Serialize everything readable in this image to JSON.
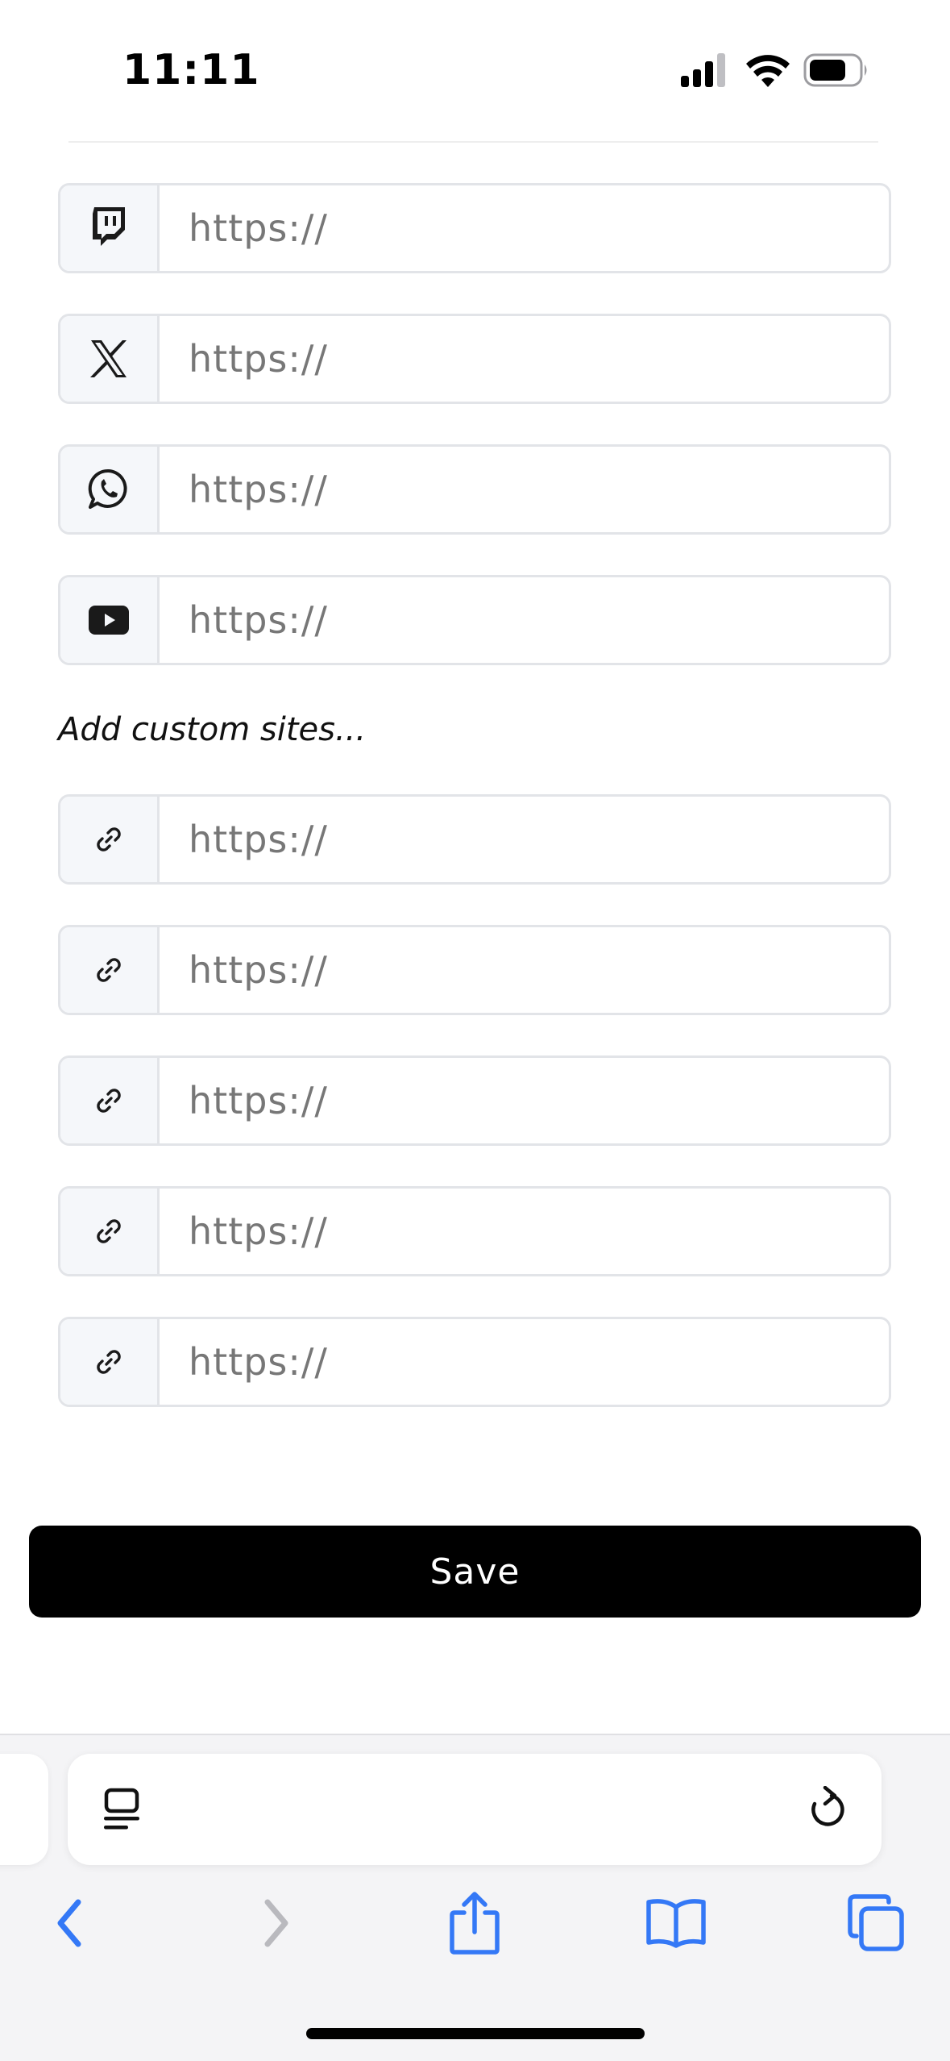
{
  "status_bar": {
    "time": "11:11",
    "icons": [
      "cellular-signal-icon",
      "wifi-icon",
      "battery-icon"
    ]
  },
  "social_links": [
    {
      "icon": "twitch-icon",
      "placeholder": "https://",
      "value": ""
    },
    {
      "icon": "x-icon",
      "placeholder": "https://",
      "value": ""
    },
    {
      "icon": "whatsapp-icon",
      "placeholder": "https://",
      "value": ""
    },
    {
      "icon": "youtube-icon",
      "placeholder": "https://",
      "value": ""
    }
  ],
  "custom_sites": {
    "heading": "Add custom sites...",
    "items": [
      {
        "icon": "link-icon",
        "placeholder": "https://",
        "value": ""
      },
      {
        "icon": "link-icon",
        "placeholder": "https://",
        "value": ""
      },
      {
        "icon": "link-icon",
        "placeholder": "https://",
        "value": ""
      },
      {
        "icon": "link-icon",
        "placeholder": "https://",
        "value": ""
      },
      {
        "icon": "link-icon",
        "placeholder": "https://",
        "value": ""
      }
    ]
  },
  "actions": {
    "save_label": "Save"
  },
  "browser": {
    "toolbar_icons": [
      "back-icon",
      "forward-icon",
      "share-icon",
      "bookmarks-icon",
      "tabs-icon"
    ],
    "address_bar_icons": [
      "page-menu-icon",
      "reload-icon"
    ],
    "accent_color": "#3478F6",
    "disabled_color": "#B9B9BE"
  },
  "colors": {
    "save_button_bg": "#000000",
    "save_button_text": "#FFFFFF",
    "input_border": "#E2E4E8",
    "addon_bg": "#F5F7FA",
    "placeholder_text": "#777777"
  }
}
